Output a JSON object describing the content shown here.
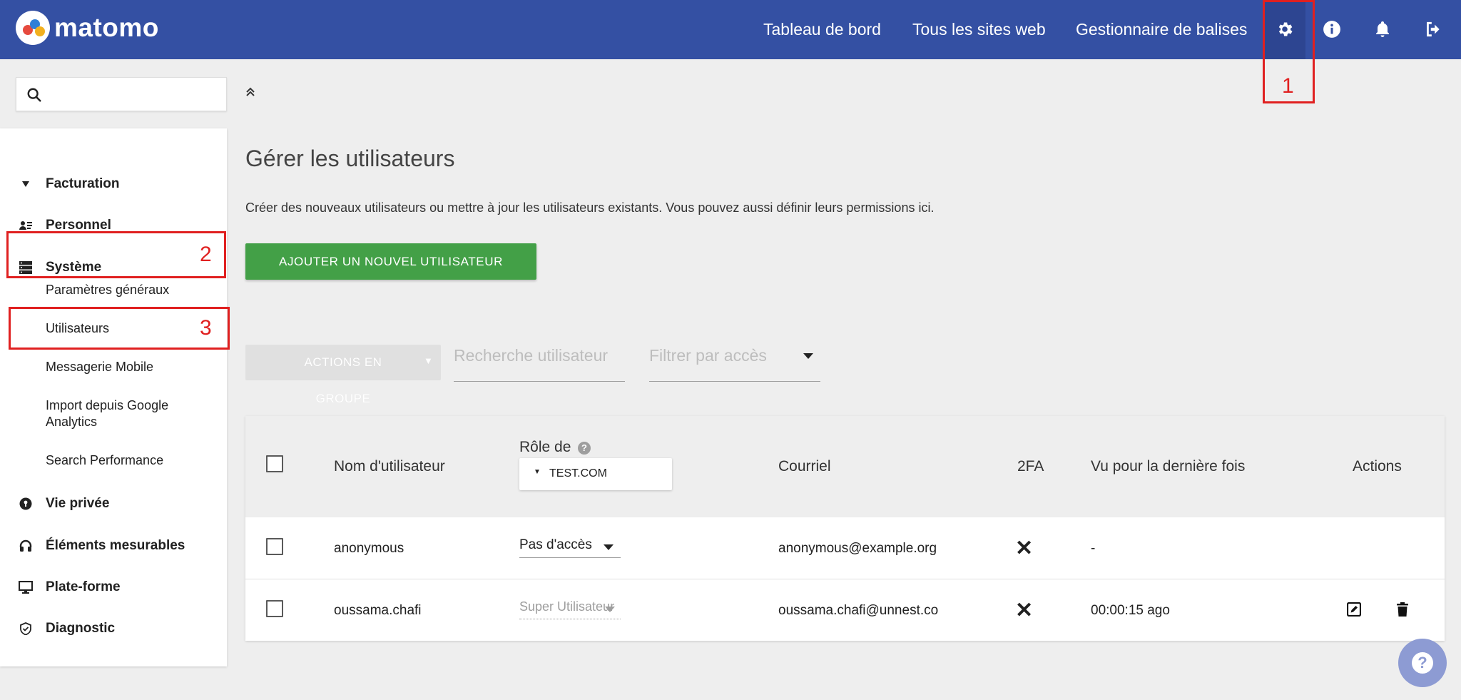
{
  "app": {
    "logo_text": "matomo",
    "nav": [
      "Tableau de bord",
      "Tous les sites web",
      "Gestionnaire de balises"
    ]
  },
  "annotations": [
    "1",
    "2",
    "3"
  ],
  "sidebar": {
    "search_placeholder": "",
    "categories": [
      {
        "label": "Facturation",
        "icon": "triangle-down-icon"
      },
      {
        "label": "Personnel",
        "icon": "user-card-icon"
      },
      {
        "label": "Système",
        "icon": "server-icon"
      },
      {
        "label": "Vie privée",
        "icon": "privacy-icon"
      },
      {
        "label": "Éléments mesurables",
        "icon": "headset-icon"
      },
      {
        "label": "Plate-forme",
        "icon": "monitor-icon"
      },
      {
        "label": "Diagnostic",
        "icon": "shield-check-icon"
      }
    ],
    "system_items": [
      "Paramètres généraux",
      "Utilisateurs",
      "Messagerie Mobile",
      "Import depuis Google Analytics",
      "Search Performance"
    ]
  },
  "main": {
    "title": "Gérer les utilisateurs",
    "description": "Créer des nouveaux utilisateurs ou mettre à jour les utilisateurs existants. Vous pouvez aussi définir leurs permissions ici.",
    "add_button": "AJOUTER UN NOUVEL UTILISATEUR",
    "bulk_actions_line1": "ACTIONS EN",
    "bulk_actions_line2": "GROUPE",
    "search_placeholder": "Recherche utilisateur",
    "filter_placeholder": "Filtrer par accès"
  },
  "table": {
    "headers": {
      "username": "Nom d'utilisateur",
      "role": "Rôle de",
      "site": "TEST.COM",
      "email": "Courriel",
      "twofa": "2FA",
      "last_seen": "Vu pour la dernière fois",
      "actions": "Actions"
    },
    "rows": [
      {
        "username": "anonymous",
        "role": "Pas d'accès",
        "email": "anonymous@example.org",
        "twofa": "✕",
        "last_seen": "-"
      },
      {
        "username": "oussama.chafi",
        "role": "Super Utilisateur",
        "email": "oussama.chafi@unnest.co",
        "twofa": "✕",
        "last_seen": "00:00:15 ago"
      }
    ]
  },
  "help": {
    "label": "?"
  },
  "colors": {
    "header": "#3450a3",
    "accent_green": "#43a047",
    "annotation": "#e02020"
  }
}
